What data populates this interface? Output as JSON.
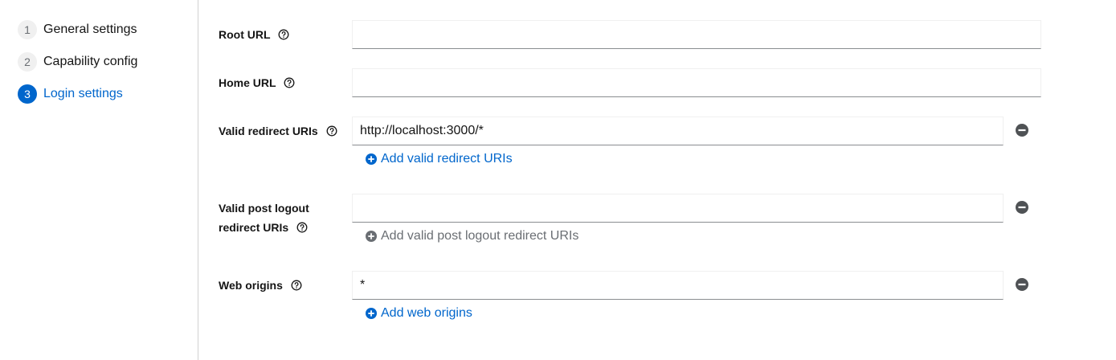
{
  "wizard": {
    "steps": [
      {
        "number": "1",
        "label": "General settings",
        "state": "done"
      },
      {
        "number": "2",
        "label": "Capability config",
        "state": "done"
      },
      {
        "number": "3",
        "label": "Login settings",
        "state": "current"
      }
    ]
  },
  "form": {
    "root_url": {
      "label": "Root URL",
      "value": ""
    },
    "home_url": {
      "label": "Home URL",
      "value": ""
    },
    "valid_redirect_uris": {
      "label": "Valid redirect URIs",
      "values": [
        "http://localhost:3000/*"
      ],
      "add_label": "Add valid redirect URIs"
    },
    "valid_post_logout": {
      "label_line1": "Valid post logout",
      "label_line2": "redirect URIs",
      "values": [
        ""
      ],
      "add_label": "Add valid post logout redirect URIs",
      "add_disabled": true
    },
    "web_origins": {
      "label": "Web origins",
      "values": [
        "*"
      ],
      "add_label": "Add web origins"
    }
  },
  "colors": {
    "accent": "#0066cc",
    "icon_gray": "#6a6e73",
    "remove_icon": "#4f5255",
    "border": "#d2d2d2"
  }
}
